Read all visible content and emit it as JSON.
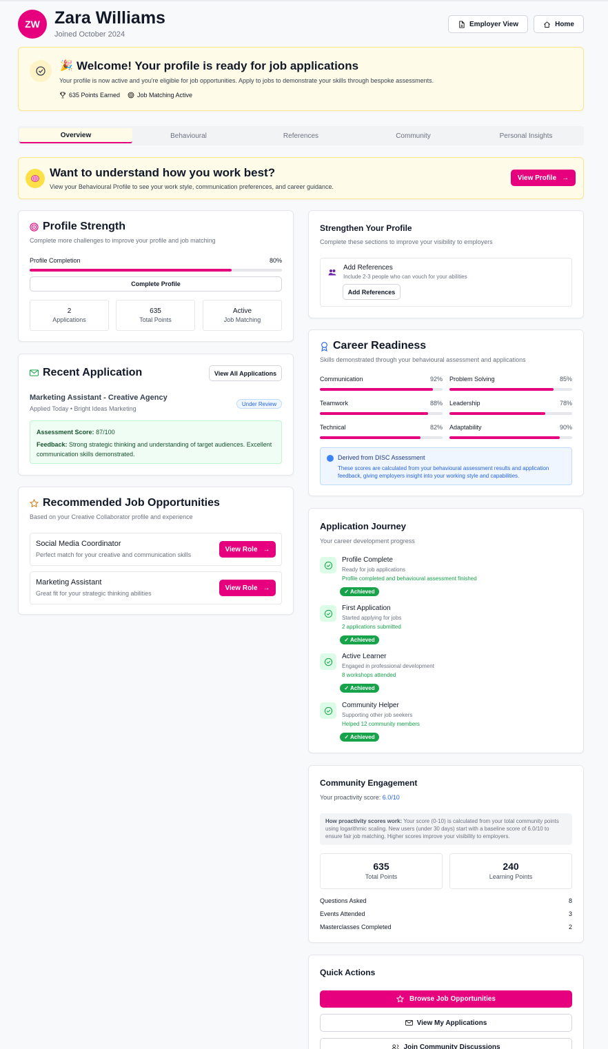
{
  "user": {
    "initials": "ZW",
    "name": "Zara Williams",
    "joined": "Joined October 2024"
  },
  "header": {
    "employer_view": "Employer View",
    "home": "Home"
  },
  "welcome": {
    "emoji": "🎉",
    "title": "Welcome! Your profile is ready for job applications",
    "text": "Your profile is now active and you're eligible for job opportunities. Apply to jobs to demonstrate your skills through bespoke assessments.",
    "points": "635 Points Earned",
    "matching": "Job Matching Active"
  },
  "tabs": [
    "Overview",
    "Behavioural",
    "References",
    "Community",
    "Personal Insights"
  ],
  "behaviour_banner": {
    "title": "Want to understand how you work best?",
    "text": "View your Behavioural Profile to see your work style, communication preferences, and career guidance.",
    "button": "View Profile"
  },
  "profile_strength": {
    "title": "Profile Strength",
    "subtitle": "Complete more challenges to improve your profile and job matching",
    "completion_label": "Profile Completion",
    "completion_value": "80%",
    "completion_fraction": 0.8,
    "button": "Complete Profile",
    "stats": [
      {
        "value": "2",
        "label": "Applications"
      },
      {
        "value": "635",
        "label": "Total Points"
      },
      {
        "value": "Active",
        "label": "Job Matching"
      }
    ]
  },
  "recent_application": {
    "title": "Recent Application",
    "button": "View All Applications",
    "job": "Marketing Assistant - Creative Agency",
    "meta": "Applied Today • Bright Ideas Marketing",
    "status": "Under Review",
    "score_label": "Assessment Score:",
    "score_value": "87/100",
    "feedback_label": "Feedback:",
    "feedback_text": "Strong strategic thinking and understanding of target audiences. Excellent communication skills demonstrated."
  },
  "recommended": {
    "title": "Recommended Job Opportunities",
    "subtitle": "Based on your Creative Collaborator profile and experience",
    "jobs": [
      {
        "title": "Social Media Coordinator",
        "desc": "Perfect match for your creative and communication skills",
        "button": "View Role"
      },
      {
        "title": "Marketing Assistant",
        "desc": "Great fit for your strategic thinking abilities",
        "button": "View Role"
      }
    ]
  },
  "strengthen": {
    "title": "Strengthen Your Profile",
    "subtitle": "Complete these sections to improve your visibility to employers",
    "item_title": "Add References",
    "item_desc": "Include 2-3 people who can vouch for your abilities",
    "item_button": "Add References"
  },
  "career": {
    "title": "Career Readiness",
    "subtitle": "Skills demonstrated through your behavioural assessment and applications",
    "skills": [
      {
        "name": "Communication",
        "value": "92%",
        "fraction": 0.92
      },
      {
        "name": "Problem Solving",
        "value": "85%",
        "fraction": 0.85
      },
      {
        "name": "Teamwork",
        "value": "88%",
        "fraction": 0.88
      },
      {
        "name": "Leadership",
        "value": "78%",
        "fraction": 0.78
      },
      {
        "name": "Technical",
        "value": "82%",
        "fraction": 0.82
      },
      {
        "name": "Adaptability",
        "value": "90%",
        "fraction": 0.9
      }
    ],
    "info_title": "Derived from DISC Assessment",
    "info_text": "These scores are calculated from your behavioural assessment results and application feedback, giving employers insight into your working style and capabilities."
  },
  "journey": {
    "title": "Application Journey",
    "subtitle": "Your career development progress",
    "badge": "✓ Achieved",
    "steps": [
      {
        "title": "Profile Complete",
        "desc": "Ready for job applications",
        "note": "Profile completed and behavioural assessment finished"
      },
      {
        "title": "First Application",
        "desc": "Started applying for jobs",
        "note": "2 applications submitted"
      },
      {
        "title": "Active Learner",
        "desc": "Engaged in professional development",
        "note": "8 workshops attended"
      },
      {
        "title": "Community Helper",
        "desc": "Supporting other job seekers",
        "note": "Helped 12 community members"
      }
    ]
  },
  "community": {
    "title": "Community Engagement",
    "score_label": "Your proactivity score:",
    "score_value": "6.0/10",
    "info_label": "How proactivity scores work:",
    "info_text": "Your score (0-10) is calculated from your total community points using logarithmic scaling. New users (under 30 days) start with a baseline score of 6.0/10 to ensure fair job matching. Higher scores improve your visibility to employers.",
    "stats": [
      {
        "value": "635",
        "label": "Total Points"
      },
      {
        "value": "240",
        "label": "Learning Points"
      }
    ],
    "rows": [
      {
        "label": "Questions Asked",
        "value": "8"
      },
      {
        "label": "Events Attended",
        "value": "3"
      },
      {
        "label": "Masterclasses Completed",
        "value": "2"
      }
    ]
  },
  "quick_actions": {
    "title": "Quick Actions",
    "browse": "Browse Job Opportunities",
    "view_apps": "View My Applications",
    "join": "Join Community Discussions"
  },
  "colors": {
    "accent": "#e6007e",
    "success": "#16a34a",
    "info": "#2563eb",
    "banner": "#fefce8"
  }
}
